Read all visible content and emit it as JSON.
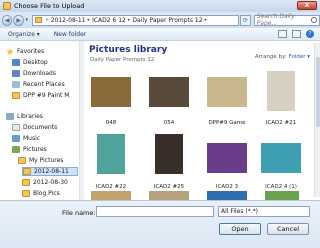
{
  "window": {
    "title": "Choose File to Upload",
    "close_label": "X"
  },
  "address": {
    "crumbs": [
      "2012-08-11",
      "ICAD2 6 12",
      "Daily Paper Prompts 12"
    ],
    "search_placeholder": "Search Daily Pape..."
  },
  "toolbar": {
    "organize": "Organize ▾",
    "new_folder": "New folder",
    "help_label": "?"
  },
  "sidebar": {
    "items": [
      {
        "label": "Favorites",
        "icon": "star-icon"
      },
      {
        "label": "Desktop",
        "icon": "desktop-icon"
      },
      {
        "label": "Downloads",
        "icon": "downloads-icon"
      },
      {
        "label": "Recent Places",
        "icon": "recent-places-icon"
      },
      {
        "label": "DPP #9 Paint M",
        "icon": "folder-icon"
      },
      {
        "label": "Libraries",
        "icon": "libraries-icon"
      },
      {
        "label": "Documents",
        "icon": "documents-icon"
      },
      {
        "label": "Music",
        "icon": "music-icon"
      },
      {
        "label": "Pictures",
        "icon": "pictures-icon"
      },
      {
        "label": "My Pictures",
        "icon": "folder-icon"
      },
      {
        "label": "2012-08-11",
        "icon": "folder-icon",
        "selected": true
      },
      {
        "label": "2012-08-30",
        "icon": "folder-icon"
      },
      {
        "label": "Blog Pics",
        "icon": "folder-icon"
      }
    ]
  },
  "main": {
    "title": "Pictures library",
    "subtitle": "Daily Paper Prompts 12",
    "arrange_label": "Arrange by:",
    "arrange_value": "Folder ▾",
    "thumbnails": [
      {
        "caption": "048",
        "color": "#8a6a3a"
      },
      {
        "caption": "054",
        "color": "#5a4a3c"
      },
      {
        "caption": "DPP#9 Game",
        "color": "#c9b88e"
      },
      {
        "caption": "ICAD2 #21",
        "color": "#d7d0c2"
      },
      {
        "caption": "ICAD2 #22",
        "color": "#4fa39a"
      },
      {
        "caption": "ICAD2 #25",
        "color": "#3a2e2a"
      },
      {
        "caption": "ICAD2 3",
        "color": "#6a3d8a"
      },
      {
        "caption": "ICAD2 4 (1)",
        "color": "#3d9fb0"
      },
      {
        "caption": "",
        "color": "#c2a36a"
      },
      {
        "caption": "",
        "color": "#b7a17c"
      },
      {
        "caption": "",
        "color": "#2e6fb0"
      },
      {
        "caption": "",
        "color": "#6aa24e"
      }
    ]
  },
  "bottom": {
    "file_name_label": "File name:",
    "file_name_value": "",
    "file_type": "All Files (*.*)",
    "open": "Open",
    "cancel": "Cancel"
  }
}
